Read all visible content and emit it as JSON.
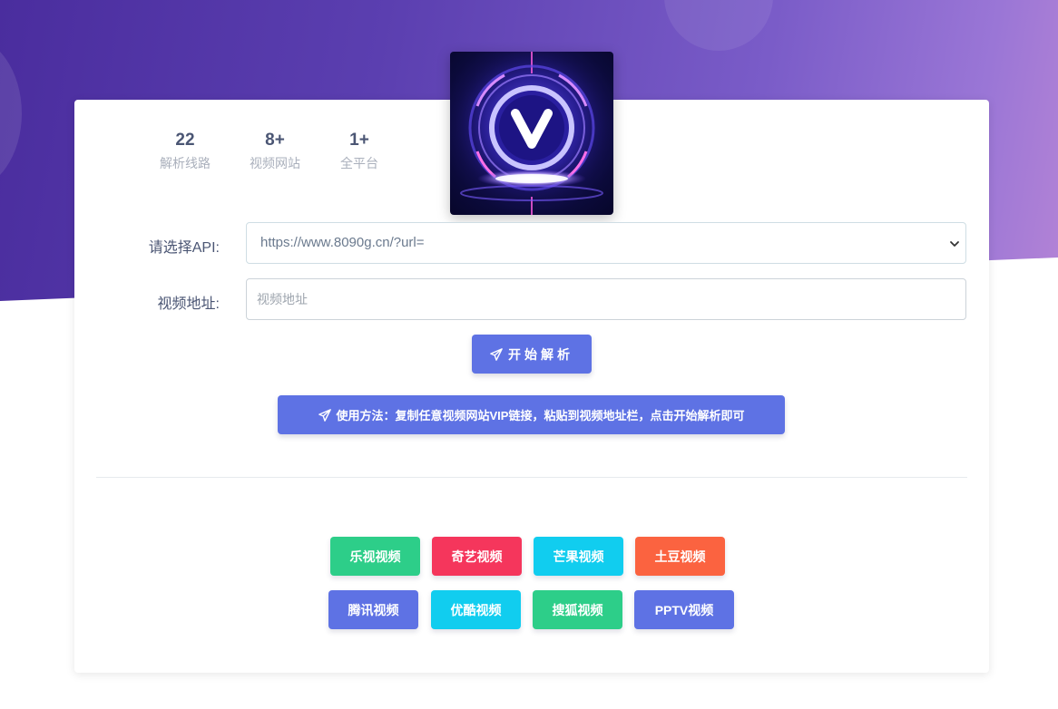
{
  "stats": [
    {
      "value": "22",
      "label": "解析线路"
    },
    {
      "value": "8+",
      "label": "视频网站"
    },
    {
      "value": "1+",
      "label": "全平台"
    }
  ],
  "logo": {
    "letter": "V",
    "icon": "vip-v-logo-icon"
  },
  "form": {
    "api_label": "请选择API:",
    "api_selected": "https://www.8090g.cn/?url=",
    "url_label": "视频地址:",
    "url_placeholder": "视频地址"
  },
  "buttons": {
    "parse_label": "开始解析",
    "usage_label": "使用方法：复制任意视频网站VIP链接，粘贴到视频地址栏，点击开始解析即可"
  },
  "sites": [
    {
      "label": "乐视视频",
      "color": "#2dce89"
    },
    {
      "label": "奇艺视频",
      "color": "#f5365c"
    },
    {
      "label": "芒果视频",
      "color": "#11cdef"
    },
    {
      "label": "土豆视频",
      "color": "#fb6340"
    },
    {
      "label": "腾讯视频",
      "color": "#5e72e4"
    },
    {
      "label": "优酷视频",
      "color": "#11cdef"
    },
    {
      "label": "搜狐视频",
      "color": "#2dce89"
    },
    {
      "label": "PPTV视频",
      "color": "#5e72e4"
    }
  ],
  "colors": {
    "primary": "#5e72e4",
    "hero_start": "#4a2d9e",
    "hero_end": "#b383d6"
  }
}
